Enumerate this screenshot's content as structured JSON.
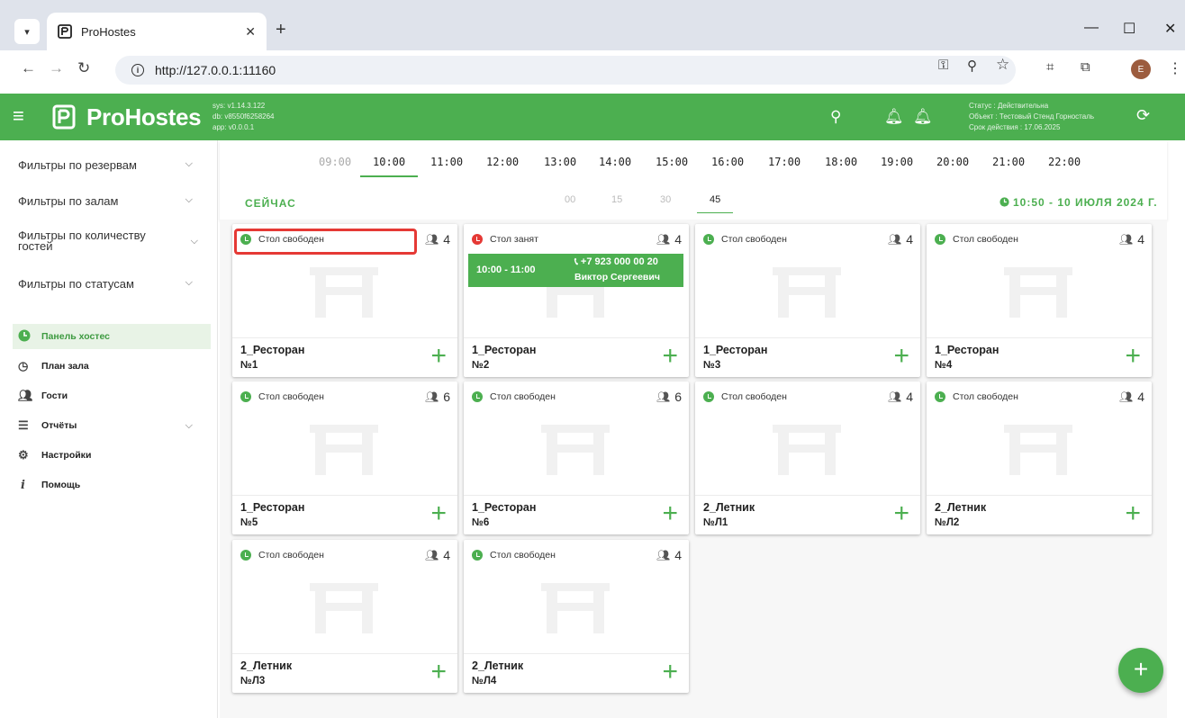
{
  "browser": {
    "tab_title": "ProHostes",
    "url": "http://127.0.0.1:11160",
    "profile_initial": "E"
  },
  "header": {
    "brand": "ProHostes",
    "versions": [
      "sys: v1.14.3.122",
      "db: v8550f6258264",
      "app: v0.0.0.1"
    ],
    "status_lines": [
      "Статус : Действительна",
      "Объект : Тестовый Стенд Горносталь",
      "Срок действия : 17.06.2025"
    ]
  },
  "sidebar": {
    "filters": [
      {
        "label": "Фильтры по резервам"
      },
      {
        "label": "Фильтры по залам"
      },
      {
        "label": "Фильтры по количеству гостей"
      },
      {
        "label": "Фильтры по статусам"
      }
    ],
    "nav": [
      {
        "label": "Панель хостес",
        "icon": "clock-icon",
        "active": true
      },
      {
        "label": "План зала",
        "icon": "plan-icon"
      },
      {
        "label": "Гости",
        "icon": "people-icon"
      },
      {
        "label": "Отчёты",
        "icon": "report-icon",
        "has_submenu": true
      },
      {
        "label": "Настройки",
        "icon": "gear-icon"
      },
      {
        "label": "Помощь",
        "icon": "info-icon"
      }
    ]
  },
  "timeline": {
    "hours": [
      "09:00",
      "10:00",
      "11:00",
      "12:00",
      "13:00",
      "14:00",
      "15:00",
      "16:00",
      "17:00",
      "18:00",
      "19:00",
      "20:00",
      "21:00",
      "22:00"
    ],
    "active_hour": "10:00",
    "now_label": "СЕЙЧАС",
    "minutes": [
      "00",
      "15",
      "30",
      "45"
    ],
    "active_minute": "45",
    "clock": "10:50 - 10 ИЮЛЯ 2024 Г."
  },
  "tables": [
    {
      "status": "Стол свободен",
      "state": "free",
      "guests": "4",
      "zone": "1_Ресторан",
      "number": "№1",
      "highlighted": true
    },
    {
      "status": "Стол занят",
      "state": "busy",
      "guests": "4",
      "zone": "1_Ресторан",
      "number": "№2",
      "reservation": {
        "time": "10:00 - 11:00",
        "phone": "+7 923 000 00 20",
        "name": "Виктор Сергеевич"
      }
    },
    {
      "status": "Стол свободен",
      "state": "free",
      "guests": "4",
      "zone": "1_Ресторан",
      "number": "№3"
    },
    {
      "status": "Стол свободен",
      "state": "free",
      "guests": "4",
      "zone": "1_Ресторан",
      "number": "№4"
    },
    {
      "status": "Стол свободен",
      "state": "free",
      "guests": "6",
      "zone": "1_Ресторан",
      "number": "№5"
    },
    {
      "status": "Стол свободен",
      "state": "free",
      "guests": "6",
      "zone": "1_Ресторан",
      "number": "№6"
    },
    {
      "status": "Стол свободен",
      "state": "free",
      "guests": "4",
      "zone": "2_Летник",
      "number": "№Л1"
    },
    {
      "status": "Стол свободен",
      "state": "free",
      "guests": "4",
      "zone": "2_Летник",
      "number": "№Л2"
    },
    {
      "status": "Стол свободен",
      "state": "free",
      "guests": "4",
      "zone": "2_Летник",
      "number": "№Л3"
    },
    {
      "status": "Стол свободен",
      "state": "free",
      "guests": "4",
      "zone": "2_Летник",
      "number": "№Л4"
    }
  ],
  "colors": {
    "brand": "#4caf50",
    "busy": "#e53935",
    "highlight": "#e53935"
  }
}
